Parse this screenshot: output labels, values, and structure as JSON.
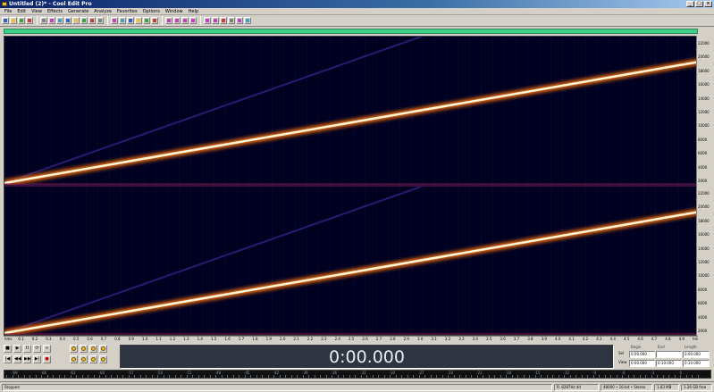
{
  "window": {
    "title": "Untitled (2)* - Cool Edit Pro",
    "buttons": [
      "_",
      "□",
      "×"
    ]
  },
  "menu": [
    "File",
    "Edit",
    "View",
    "Effects",
    "Generate",
    "Analyze",
    "Favorites",
    "Options",
    "Window",
    "Help"
  ],
  "toolbar": {
    "icons": [
      "new-icon",
      "open-icon",
      "save-icon",
      "multitrack-icon",
      "cut-icon",
      "copy-icon",
      "paste-icon",
      "mix-paste-icon",
      "trim-icon",
      "silence-icon",
      "undo-icon",
      "redo-icon",
      "repeat-icon",
      "record-icon",
      "waveform-view-icon",
      "spectral-view-icon",
      "zoom-icon",
      "scrub-icon",
      "settings-icon",
      "marker-icon",
      "cd-icon",
      "mix-icon",
      "favorite-icon",
      "analyze-icon",
      "amplify-icon",
      "reverse-icon",
      "invert-icon",
      "help-icon"
    ],
    "accent": "#c040c0"
  },
  "display": {
    "view": "spectral",
    "colors": {
      "background": "#000020",
      "sweep_core": "#fff6d8",
      "sweep_glow": "#e86a10",
      "harmonic": "#2a1a70",
      "overview": "#3fcf88"
    },
    "sweep_endpoint_fraction": 0.83,
    "harmonic_endpoint_fraction": 0.58
  },
  "freq_scale": {
    "left_ticks": [
      "22000",
      "20000",
      "18000",
      "16000",
      "14000",
      "12000",
      "10000",
      "8000",
      "6000",
      "4000",
      "2000"
    ],
    "right_ticks": [
      "22000",
      "20000",
      "18000",
      "16000",
      "14000",
      "12000",
      "10000",
      "8000",
      "6000",
      "4000",
      "2000"
    ]
  },
  "time_ruler": {
    "ticks": [
      "hms",
      "0.1",
      "0.2",
      "0.3",
      "0.4",
      "0.5",
      "0.6",
      "0.7",
      "0.8",
      "0.9",
      "1.0",
      "1.1",
      "1.2",
      "1.3",
      "1.4",
      "1.5",
      "1.6",
      "1.7",
      "1.8",
      "1.9",
      "2.0",
      "2.1",
      "2.2",
      "2.3",
      "2.4",
      "2.5",
      "2.6",
      "2.7",
      "2.8",
      "2.9",
      "3.0",
      "3.1",
      "3.2",
      "3.3",
      "3.4",
      "3.5",
      "3.6",
      "3.7",
      "3.8",
      "3.9",
      "4.0",
      "4.1",
      "4.2",
      "4.3",
      "4.4",
      "4.5",
      "4.6",
      "4.7",
      "4.8",
      "4.9",
      "hms"
    ]
  },
  "transport": {
    "row1": [
      "■",
      "▶",
      "II",
      "⟳",
      "∞"
    ],
    "row2": [
      "|◀",
      "◀◀",
      "▶▶",
      "▶|",
      "●"
    ]
  },
  "time_display": "0:00.000",
  "selection": {
    "headers": [
      "Begin",
      "End",
      "Length"
    ],
    "sel_label": "Sel",
    "view_label": "View",
    "sel_begin": "0:00.000",
    "sel_end": "",
    "sel_length": "0:00.000",
    "view_begin": "0:00.000",
    "view_end": "0:10.000",
    "view_length": "0:10.000"
  },
  "level_meter": {
    "ticks": [
      "-69",
      "-66",
      "-63",
      "-60",
      "-57",
      "-54",
      "-51",
      "-48",
      "-45",
      "-42",
      "-39",
      "-36",
      "-33",
      "-30",
      "-27",
      "-24",
      "-21",
      "-18",
      "-15",
      "-12",
      "-9",
      "-6",
      "-3",
      "0"
    ]
  },
  "status": {
    "state": "Stopped",
    "cursor": "R: 8287Hz 4d",
    "format": "48000 • 16-bit • Stereo",
    "size": "1.83 MB",
    "free": "1.26 GB free"
  }
}
